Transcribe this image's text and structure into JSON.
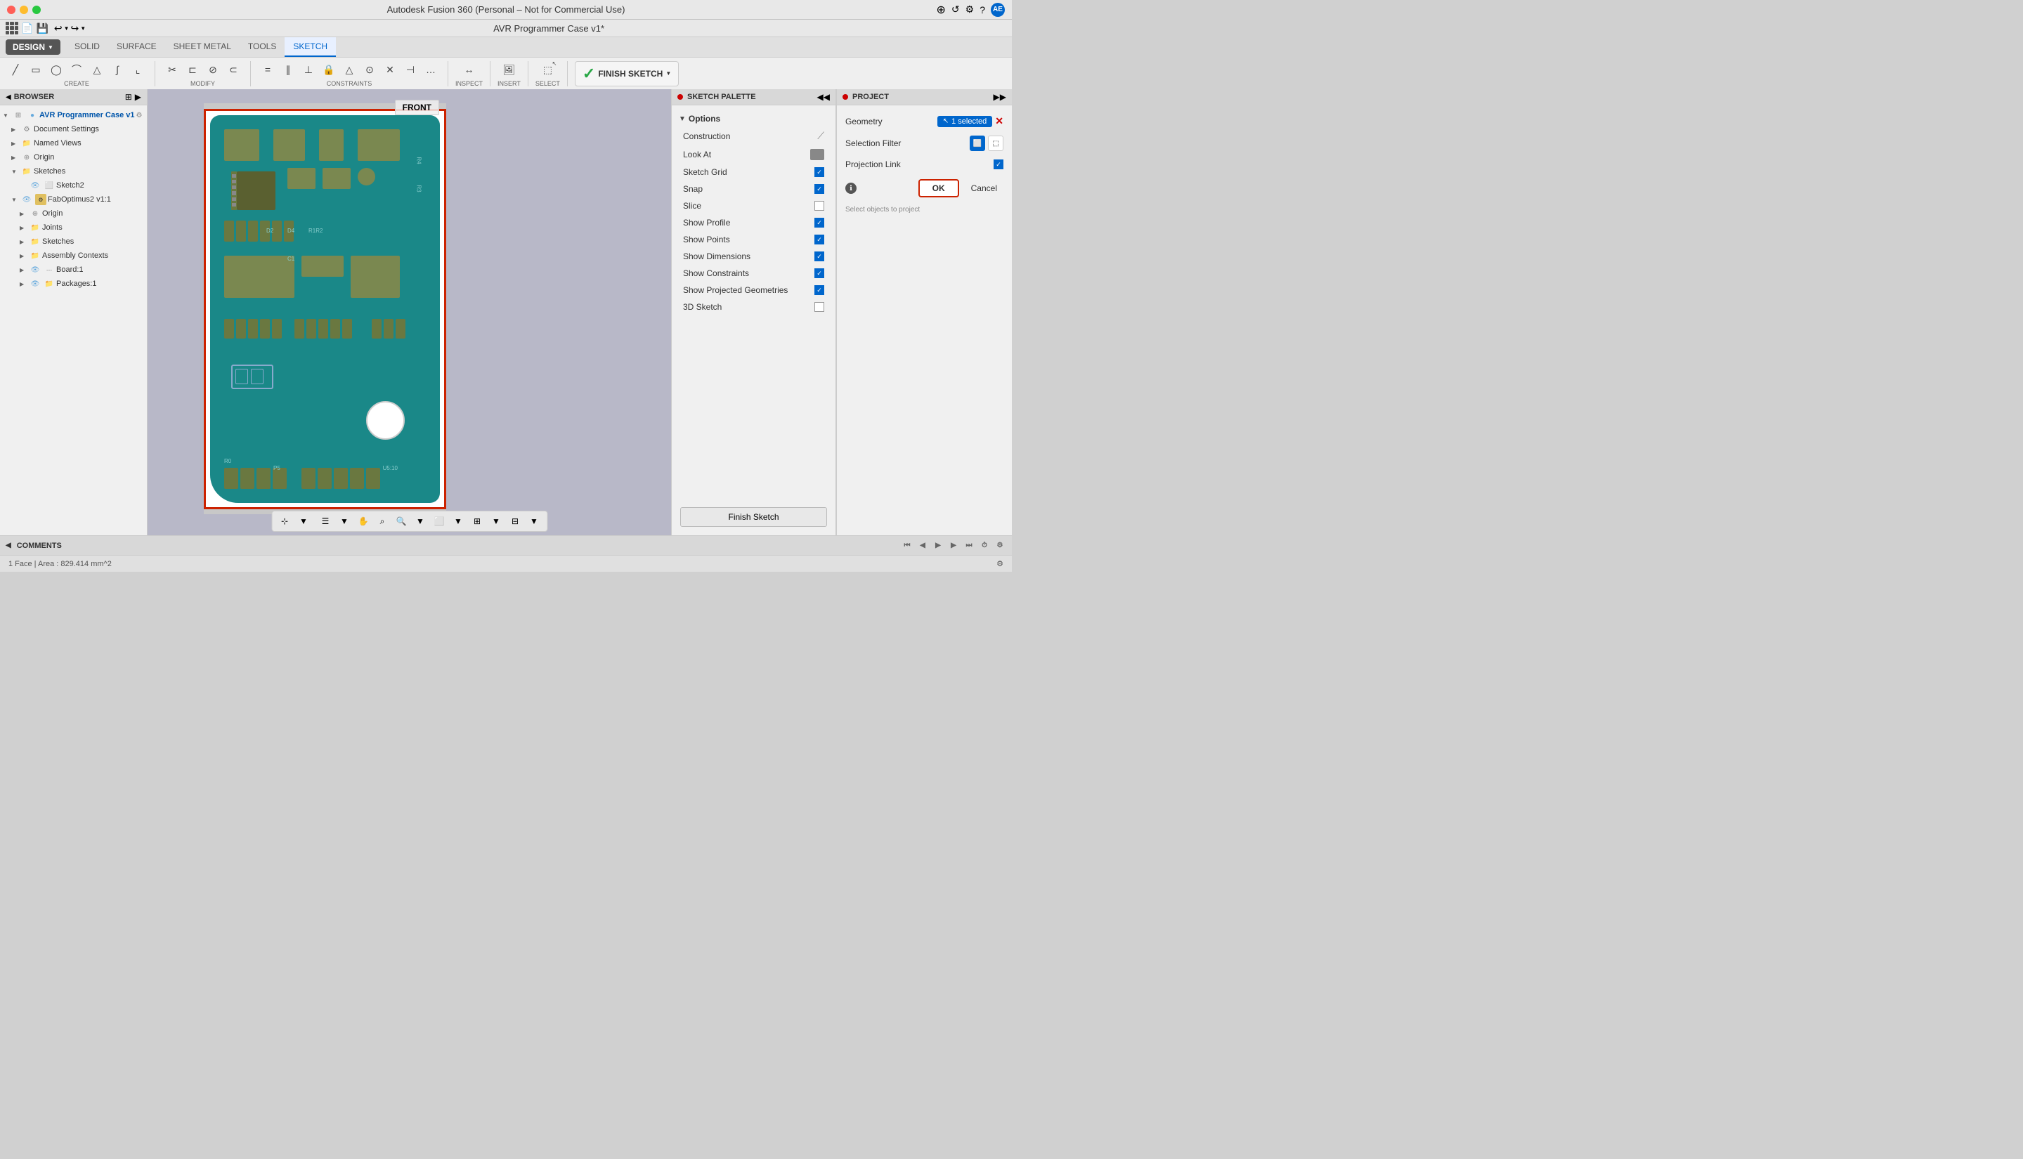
{
  "titlebar": {
    "title": "Autodesk Fusion 360 (Personal – Not for Commercial Use)",
    "app_title": "AVR Programmer Case v1*"
  },
  "toolbar": {
    "tabs": [
      "SOLID",
      "SURFACE",
      "SHEET METAL",
      "TOOLS",
      "SKETCH"
    ],
    "active_tab": "SKETCH",
    "groups": {
      "create": "CREATE",
      "modify": "MODIFY",
      "constraints": "CONSTRAINTS",
      "inspect": "INSPECT",
      "insert": "INSERT",
      "select": "SELECT",
      "finish_sketch": "FINISH SKETCH"
    },
    "design_label": "DESIGN",
    "finish_sketch_label": "FINISH SKETCH"
  },
  "browser": {
    "title": "BROWSER",
    "items": [
      {
        "id": "root",
        "label": "AVR Programmer Case v1",
        "indent": 0,
        "type": "component",
        "expanded": true
      },
      {
        "id": "doc-settings",
        "label": "Document Settings",
        "indent": 1,
        "type": "gear"
      },
      {
        "id": "named-views",
        "label": "Named Views",
        "indent": 1,
        "type": "folder"
      },
      {
        "id": "origin",
        "label": "Origin",
        "indent": 1,
        "type": "origin"
      },
      {
        "id": "sketches",
        "label": "Sketches",
        "indent": 1,
        "type": "folder",
        "expanded": true
      },
      {
        "id": "sketch2",
        "label": "Sketch2",
        "indent": 2,
        "type": "sketch"
      },
      {
        "id": "faboptimus",
        "label": "FabOptimus2 v1:1",
        "indent": 1,
        "type": "component",
        "expanded": true
      },
      {
        "id": "origin2",
        "label": "Origin",
        "indent": 2,
        "type": "origin"
      },
      {
        "id": "joints",
        "label": "Joints",
        "indent": 2,
        "type": "folder"
      },
      {
        "id": "sketches2",
        "label": "Sketches",
        "indent": 2,
        "type": "folder"
      },
      {
        "id": "assembly",
        "label": "Assembly Contexts",
        "indent": 2,
        "type": "folder"
      },
      {
        "id": "board1",
        "label": "Board:1",
        "indent": 2,
        "type": "board"
      },
      {
        "id": "packages1",
        "label": "Packages:1",
        "indent": 2,
        "type": "package"
      }
    ]
  },
  "canvas": {
    "view_label": "FRONT"
  },
  "sketch_palette": {
    "title": "SKETCH PALETTE",
    "sections": {
      "options": {
        "label": "Options",
        "expanded": true,
        "items": [
          {
            "label": "Construction",
            "type": "angle_icon",
            "checked": false
          },
          {
            "label": "Look At",
            "type": "look_at",
            "checked": false
          },
          {
            "label": "Sketch Grid",
            "type": "checkbox",
            "checked": true
          },
          {
            "label": "Snap",
            "type": "checkbox",
            "checked": true
          },
          {
            "label": "Slice",
            "type": "checkbox",
            "checked": false
          },
          {
            "label": "Show Profile",
            "type": "checkbox",
            "checked": true
          },
          {
            "label": "Show Points",
            "type": "checkbox",
            "checked": true
          },
          {
            "label": "Show Dimensions",
            "type": "checkbox",
            "checked": true
          },
          {
            "label": "Show Constraints",
            "type": "checkbox",
            "checked": true
          },
          {
            "label": "Show Projected Geometries",
            "type": "checkbox",
            "checked": true
          },
          {
            "label": "3D Sketch",
            "type": "checkbox",
            "checked": false
          }
        ]
      }
    },
    "finish_sketch_label": "Finish Sketch"
  },
  "project_panel": {
    "title": "PROJECT",
    "geometry_label": "Geometry",
    "selection_filter_label": "Selection Filter",
    "projection_link_label": "Projection Link",
    "selected_count": "1 selected",
    "ok_label": "OK",
    "cancel_label": "Cancel",
    "hint_text": "Select objects to project"
  },
  "statusbar": {
    "face_info": "1 Face | Area : 829.414 mm^2"
  },
  "comments": {
    "title": "COMMENTS"
  }
}
